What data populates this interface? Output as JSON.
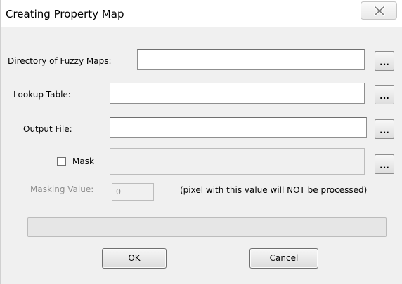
{
  "window": {
    "title": "Creating Property Map",
    "close_icon": "close-x-icon"
  },
  "form": {
    "directory_label": "Directory of Fuzzy Maps:",
    "directory_value": "",
    "lookup_label": "Lookup Table:",
    "lookup_value": "",
    "output_label": "Output File:",
    "output_value": "",
    "mask_label": "Mask",
    "mask_checked": false,
    "mask_value": "",
    "browse_label": "...",
    "masking_value_label": "Masking Value:",
    "masking_value": "0",
    "masking_note": "(pixel with this value will NOT be processed)"
  },
  "progress": {
    "value": 0
  },
  "buttons": {
    "ok_label": "OK",
    "cancel_label": "Cancel"
  }
}
